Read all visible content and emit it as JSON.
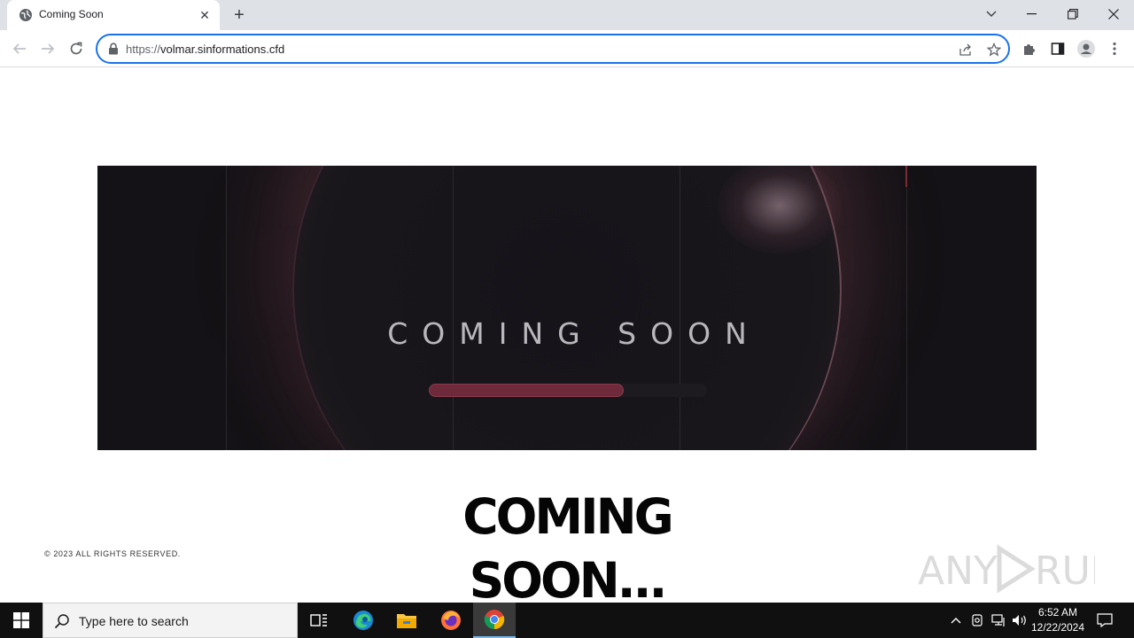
{
  "browser": {
    "tab": {
      "title": "Coming Soon",
      "close_glyph": "✕"
    },
    "new_tab_glyph": "+",
    "address": {
      "scheme": "https://",
      "host": "volmar.sinformations.cfd"
    }
  },
  "page": {
    "banner": {
      "title": "COMING SOON",
      "progress_fraction": 0.7
    },
    "heading_line1": "COMING",
    "heading_line2": "SOON...",
    "copyright": "© 2023 ALL RIGHTS RESERVED.",
    "watermark": "ANY RUN"
  },
  "taskbar": {
    "search_placeholder": "Type here to search",
    "time": "6:52 AM",
    "date": "12/22/2024"
  },
  "colors": {
    "omnibox_border": "#1a73e8",
    "banner_bg": "#141216",
    "progress_fill": "#6e2a3b",
    "taskbar_bg": "#101010"
  }
}
